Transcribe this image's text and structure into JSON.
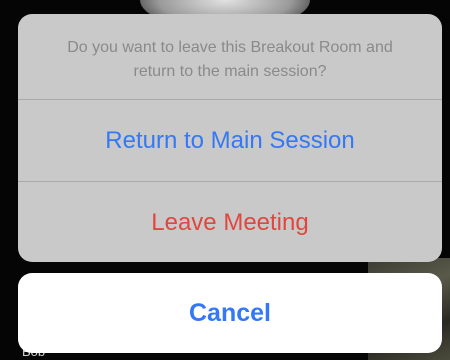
{
  "background": {
    "participant_name": "Bob"
  },
  "action_sheet": {
    "message": "Do you want to leave this Breakout Room and return to the main session?",
    "actions": [
      {
        "label": "Return to Main Session",
        "color": "#3478f6"
      },
      {
        "label": "Leave Meeting",
        "color": "#e0473f"
      }
    ]
  },
  "cancel": {
    "label": "Cancel",
    "color": "#3478f6"
  }
}
